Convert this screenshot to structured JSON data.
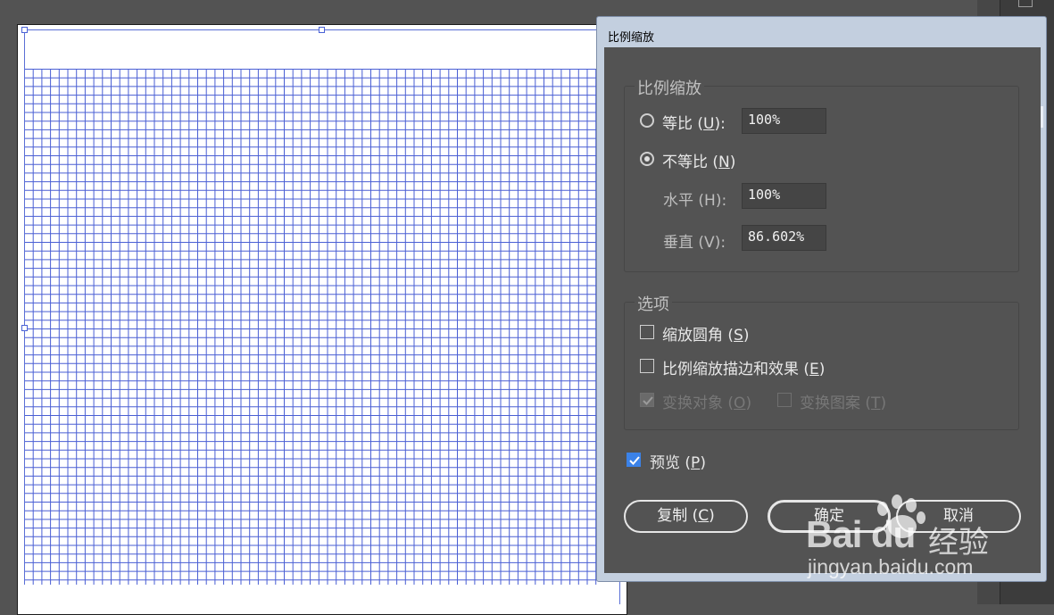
{
  "dialog": {
    "title": "比例缩放",
    "scale_group_title": "比例缩放",
    "uniform": {
      "label": "等比",
      "mnemonic": "U",
      "value": "100%",
      "selected": false
    },
    "non_uniform": {
      "label": "不等比",
      "mnemonic": "N",
      "selected": true
    },
    "horizontal": {
      "label": "水平",
      "mnemonic": "H",
      "value": "100%"
    },
    "vertical": {
      "label": "垂直",
      "mnemonic": "V",
      "value": "86.602%"
    },
    "options_group_title": "选项",
    "scale_corners": {
      "label": "缩放圆角",
      "mnemonic": "S",
      "checked": false
    },
    "scale_strokes": {
      "label": "比例缩放描边和效果",
      "mnemonic": "E",
      "checked": false
    },
    "transform_objects": {
      "label": "变换对象",
      "mnemonic": "O",
      "checked": true,
      "enabled": false
    },
    "transform_patterns": {
      "label": "变换图案",
      "mnemonic": "T",
      "checked": false,
      "enabled": false
    },
    "preview": {
      "label": "预览",
      "mnemonic": "P",
      "checked": true
    },
    "buttons": {
      "copy": {
        "label": "复制",
        "mnemonic": "C"
      },
      "ok": {
        "label": "确定"
      },
      "cancel": {
        "label": "取消"
      }
    }
  },
  "watermark": {
    "brand": "Bai du",
    "cn": "经验",
    "url": "jingyan.baidu.com"
  },
  "colors": {
    "grid": "#4a5fd4",
    "checkbox_accent": "#3b82e8",
    "dialog_frame": "#c3cfdf",
    "panel_bg": "#535353"
  }
}
